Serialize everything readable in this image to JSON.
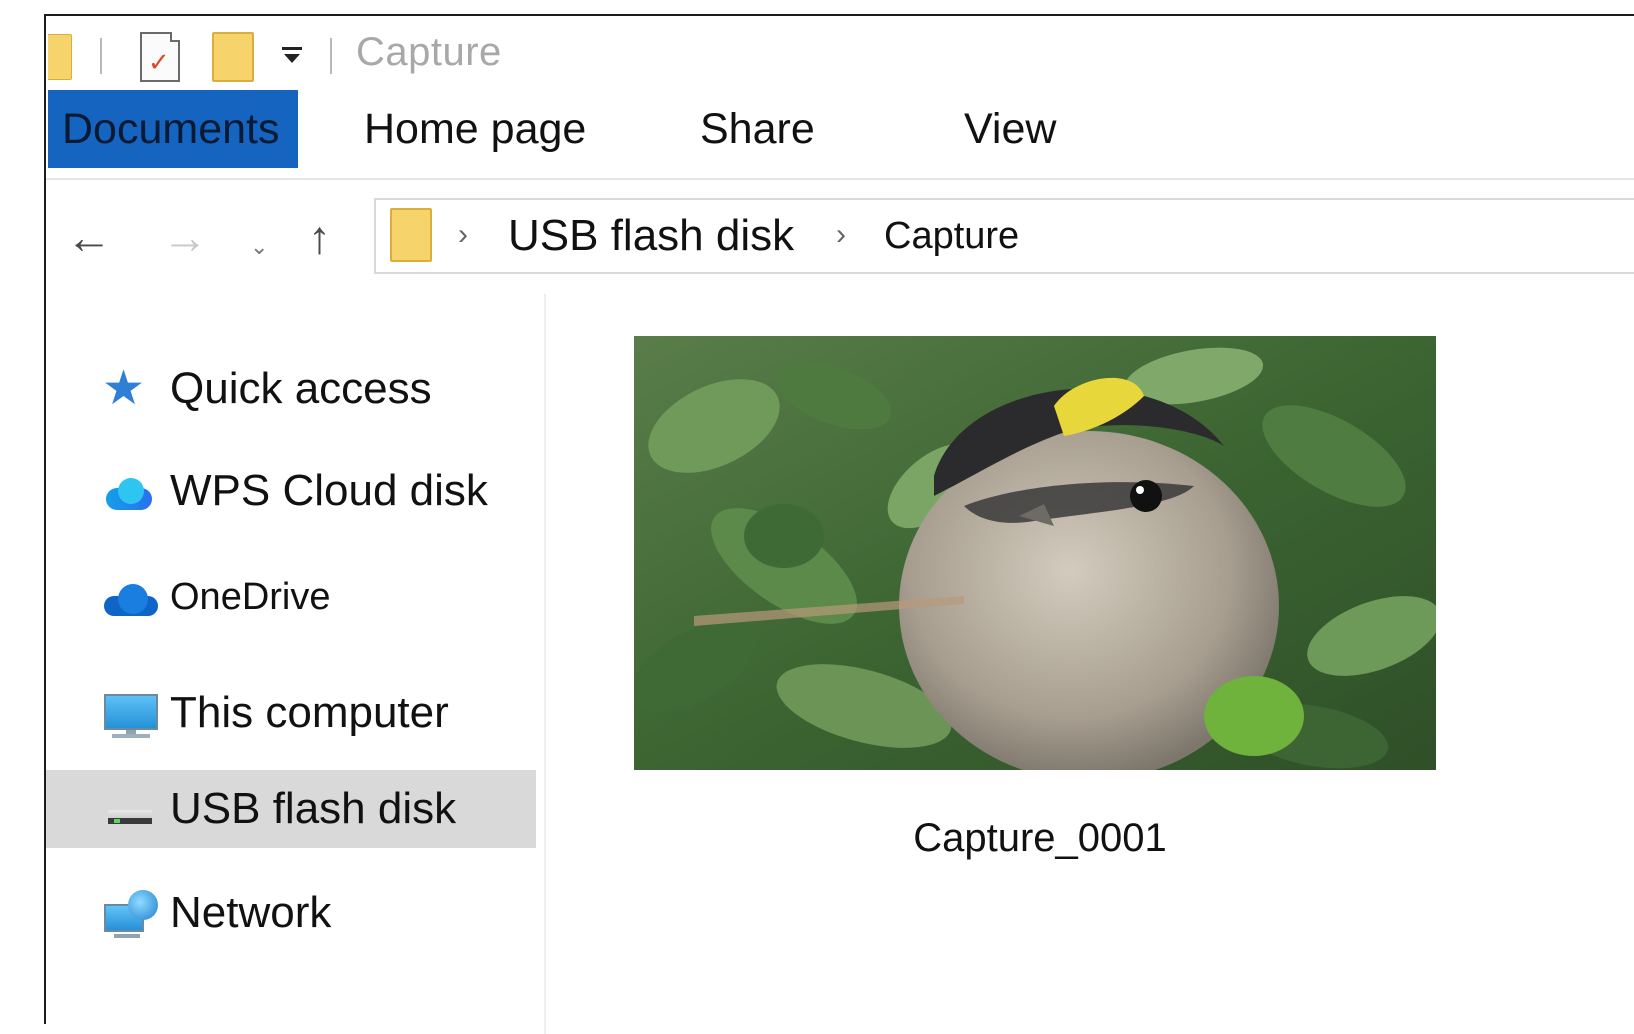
{
  "window": {
    "title": "Capture"
  },
  "ribbon": {
    "tabs": [
      {
        "label": "Documents",
        "active": true
      },
      {
        "label": "Home page",
        "active": false
      },
      {
        "label": "Share",
        "active": false
      },
      {
        "label": "View",
        "active": false
      }
    ]
  },
  "nav": {
    "back_icon": "arrow-left-icon",
    "forward_icon": "arrow-right-icon",
    "recent_icon": "chevron-down-icon",
    "up_icon": "arrow-up-icon"
  },
  "address": {
    "crumbs": [
      "USB flash disk",
      "Capture"
    ]
  },
  "sidebar": {
    "items": [
      {
        "label": "Quick access",
        "icon": "star-icon",
        "selected": false
      },
      {
        "label": "WPS Cloud disk",
        "icon": "wps-cloud-icon",
        "selected": false
      },
      {
        "label": "OneDrive",
        "icon": "onedrive-cloud-icon",
        "selected": false
      },
      {
        "label": "This computer",
        "icon": "computer-icon",
        "selected": false
      },
      {
        "label": "USB flash disk",
        "icon": "usb-drive-icon",
        "selected": true
      },
      {
        "label": "Network",
        "icon": "network-icon",
        "selected": false
      }
    ]
  },
  "files": [
    {
      "name": "Capture_0001",
      "thumbnail": "bird-photo"
    }
  ],
  "colors": {
    "accent": "#1565c0",
    "selection": "#d9d9d9",
    "folder": "#f7d46b"
  }
}
